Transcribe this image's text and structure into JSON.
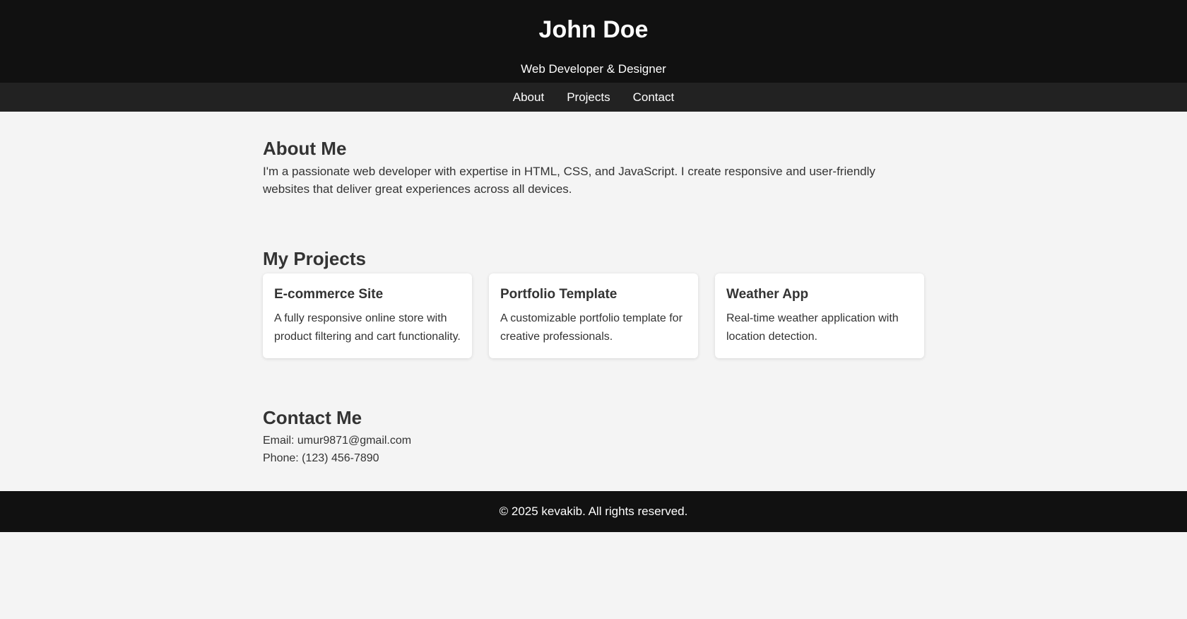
{
  "header": {
    "name": "John Doe",
    "tagline": "Web Developer & Designer"
  },
  "nav": {
    "items": [
      {
        "label": "About"
      },
      {
        "label": "Projects"
      },
      {
        "label": "Contact"
      }
    ]
  },
  "about": {
    "title": "About Me",
    "text": "I'm a passionate web developer with expertise in HTML, CSS, and JavaScript. I create responsive and user-friendly websites that deliver great experiences across all devices."
  },
  "projects": {
    "title": "My Projects",
    "cards": [
      {
        "title": "E-commerce Site",
        "description": "A fully responsive online store with product filtering and cart functionality."
      },
      {
        "title": "Portfolio Template",
        "description": "A customizable portfolio template for creative professionals."
      },
      {
        "title": "Weather App",
        "description": "Real-time weather application with location detection."
      }
    ]
  },
  "contact": {
    "title": "Contact Me",
    "email": "Email: umur9871@gmail.com",
    "phone": "Phone: (123) 456-7890"
  },
  "footer": {
    "text": "© 2025 kevakib. All rights reserved."
  },
  "colors": {
    "header_bg": "#111111",
    "nav_bg": "#222222",
    "page_bg": "#f4f4f4",
    "text": "#333333",
    "card_bg": "#ffffff"
  }
}
